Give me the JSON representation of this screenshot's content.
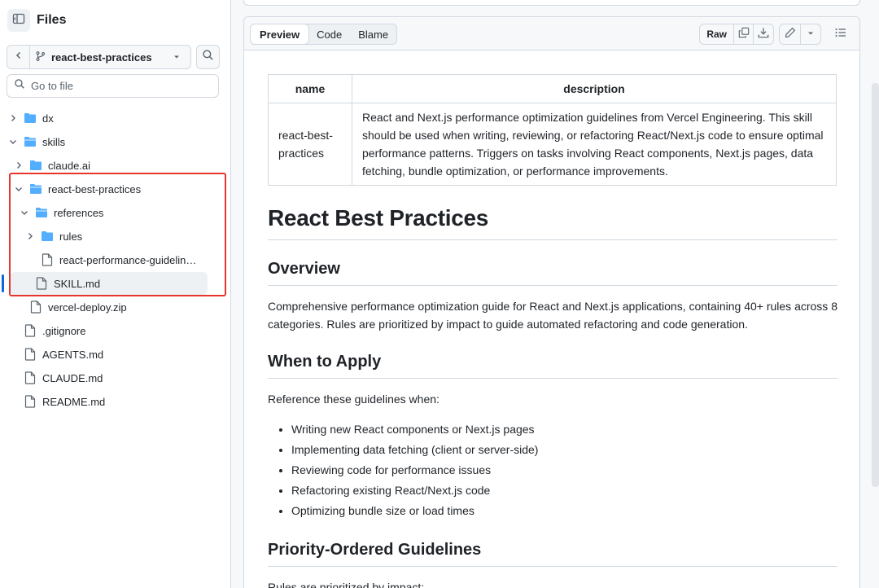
{
  "sidebar": {
    "title": "Files",
    "branch": "react-best-practices",
    "goto_placeholder": "Go to file",
    "tree": [
      {
        "label": "dx",
        "type": "folder",
        "expanded": false
      },
      {
        "label": "skills",
        "type": "folder",
        "expanded": true
      },
      {
        "label": "claude.ai",
        "type": "folder",
        "expanded": false
      },
      {
        "label": "react-best-practices",
        "type": "folder",
        "expanded": true
      },
      {
        "label": "references",
        "type": "folder",
        "expanded": true
      },
      {
        "label": "rules",
        "type": "folder",
        "expanded": false
      },
      {
        "label": "react-performance-guidelin…",
        "type": "file"
      },
      {
        "label": "SKILL.md",
        "type": "file",
        "selected": true
      },
      {
        "label": "vercel-deploy.zip",
        "type": "file"
      },
      {
        "label": ".gitignore",
        "type": "file"
      },
      {
        "label": "AGENTS.md",
        "type": "file"
      },
      {
        "label": "CLAUDE.md",
        "type": "file"
      },
      {
        "label": "README.md",
        "type": "file"
      }
    ]
  },
  "viewer": {
    "tabs": [
      "Preview",
      "Code",
      "Blame"
    ],
    "active_tab": "Preview",
    "raw_label": "Raw"
  },
  "doc": {
    "table": {
      "headers": [
        "name",
        "description"
      ],
      "rows": [
        [
          "react-best-practices",
          "React and Next.js performance optimization guidelines from Vercel Engineering. This skill should be used when writing, reviewing, or refactoring React/Next.js code to ensure optimal performance patterns. Triggers on tasks involving React components, Next.js pages, data fetching, bundle optimization, or performance improvements."
        ]
      ]
    },
    "title": "React Best Practices",
    "overview_heading": "Overview",
    "overview_text": "Comprehensive performance optimization guide for React and Next.js applications, containing 40+ rules across 8 categories. Rules are prioritized by impact to guide automated refactoring and code generation.",
    "when_heading": "When to Apply",
    "when_intro": "Reference these guidelines when:",
    "when_items": [
      "Writing new React components or Next.js pages",
      "Implementing data fetching (client or server-side)",
      "Reviewing code for performance issues",
      "Refactoring existing React/Next.js code",
      "Optimizing bundle size or load times"
    ],
    "priority_heading": "Priority-Ordered Guidelines",
    "priority_intro": "Rules are prioritized by impact:"
  },
  "colors": {
    "folder": "#54aeff",
    "accent": "#0969da",
    "highlight_box": "#e5362e"
  }
}
